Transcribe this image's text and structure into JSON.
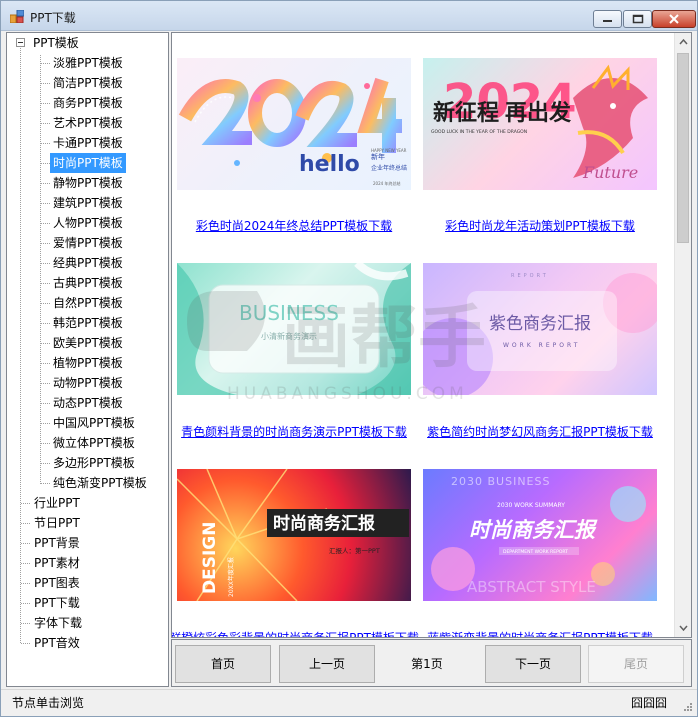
{
  "window": {
    "title": "PPT下载"
  },
  "tree": {
    "root_label": "PPT模板",
    "children": [
      "淡雅PPT模板",
      "简洁PPT模板",
      "商务PPT模板",
      "艺术PPT模板",
      "卡通PPT模板",
      "时尚PPT模板",
      "静物PPT模板",
      "建筑PPT模板",
      "人物PPT模板",
      "爱情PPT模板",
      "经典PPT模板",
      "古典PPT模板",
      "自然PPT模板",
      "韩范PPT模板",
      "欧美PPT模板",
      "植物PPT模板",
      "动物PPT模板",
      "动态PPT模板",
      "中国风PPT模板",
      "微立体PPT模板",
      "多边形PPT模板",
      "纯色渐变PPT模板"
    ],
    "selected_index": 5,
    "top_level": [
      "行业PPT",
      "节日PPT",
      "PPT背景",
      "PPT素材",
      "PPT图表",
      "PPT下载",
      "字体下载",
      "PPT音效"
    ]
  },
  "cards": [
    {
      "title": "彩色时尚2024年终总结PPT模板下载",
      "thumb": {
        "big": "2024",
        "hello": "hello",
        "sub1": "新年",
        "sub2": "企业年终总结",
        "small": "HAPPY NEW YEAR",
        "footer": "2024 年终总结"
      }
    },
    {
      "title": "彩色时尚龙年活动策划PPT模板下载",
      "thumb": {
        "big": "2024",
        "line1": "新征程",
        "line2": "再出发",
        "en": "GOOD LUCK IN THE YEAR OF THE DRAGON",
        "script": "Future"
      }
    },
    {
      "title": "青色颜料背景的时尚商务演示PPT模板下载",
      "thumb": {
        "big": "BUSINESS",
        "sub": "小清新商务演示"
      }
    },
    {
      "title": "紫色简约时尚梦幻风商务汇报PPT模板下载",
      "thumb": {
        "top": "REPORT",
        "big": "紫色商务汇报",
        "sub": "WORK REPORT"
      }
    },
    {
      "title": "鲜橙炫彩色彩背景的时尚商务汇报PPT模板下载",
      "thumb": {
        "big": "时尚商务汇报",
        "side": "DESIGN",
        "reporter": "汇报人：第一PPT",
        "year": "20XX年度汇报"
      }
    },
    {
      "title": "蓝紫渐变背景的时尚商务汇报PPT模板下载",
      "thumb": {
        "top": "2030 BUSINESS",
        "summary": "2030 WORK SUMMARY",
        "big": "时尚商务汇报",
        "sub": "DEPARTMENT WORK REPORT",
        "bottom": "ABSTRACT STYLE"
      }
    }
  ],
  "pager": {
    "first": "首页",
    "prev": "上一页",
    "info": "第1页",
    "next": "下一页",
    "last": "尾页"
  },
  "status": {
    "left": "节点单击浏览",
    "right": "囧囧囧"
  },
  "watermark": {
    "cn": "画帮手",
    "en": "HUABANGSHOU.COM"
  }
}
